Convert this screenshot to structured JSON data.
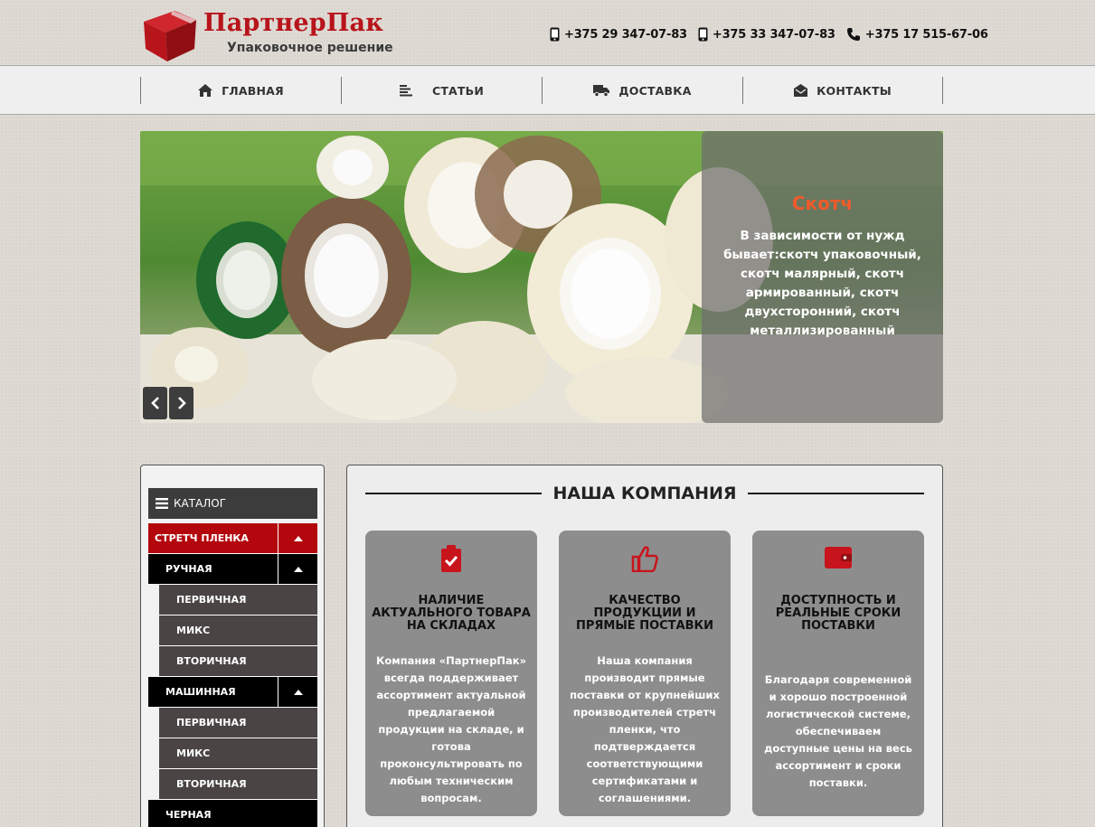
{
  "header": {
    "logo_title": "ПартнерПак",
    "logo_subtitle": "Упаковочное решение",
    "phones": [
      {
        "icon": "mobile-phone-icon",
        "number": "+375 29 347-07-83"
      },
      {
        "icon": "mobile-phone-icon",
        "number": "+375 33 347-07-83"
      },
      {
        "icon": "telephone-icon",
        "number": "+375 17 515-67-06"
      }
    ]
  },
  "nav": {
    "items": [
      {
        "label": "ГЛАВНАЯ",
        "icon": "home-icon"
      },
      {
        "label": "СТАТЬИ",
        "icon": "articles-icon"
      },
      {
        "label": "ДОСТАВКА",
        "icon": "truck-icon"
      },
      {
        "label": "КОНТАКТЫ",
        "icon": "envelope-icon"
      }
    ]
  },
  "slider": {
    "caption_title": "Скотч",
    "caption_text": "В зависимости от нужд бывает:скотч упаковочный, скотч малярный, скотч армированный, скотч двухсторонний, скотч металлизированный",
    "prev_icon": "chevron-left-icon",
    "next_icon": "chevron-right-icon"
  },
  "catalog": {
    "header": "КАТАЛОГ",
    "items": [
      {
        "label": "СТРЕТЧ ПЛЕНКА",
        "level": "red",
        "expanded": true
      },
      {
        "label": "РУЧНАЯ",
        "level": "black",
        "expanded": true
      },
      {
        "label": "ПЕРВИЧНАЯ",
        "level": "sub"
      },
      {
        "label": "МИКС",
        "level": "sub"
      },
      {
        "label": "ВТОРИЧНАЯ",
        "level": "sub"
      },
      {
        "label": "МАШИННАЯ",
        "level": "black",
        "expanded": true
      },
      {
        "label": "ПЕРВИЧНАЯ",
        "level": "sub"
      },
      {
        "label": "МИКС",
        "level": "sub"
      },
      {
        "label": "ВТОРИЧНАЯ",
        "level": "sub"
      },
      {
        "label": "ЧЕРНАЯ",
        "level": "top"
      }
    ]
  },
  "company": {
    "title": "НАША КОМПАНИЯ",
    "cards": [
      {
        "icon": "clipboard-check-icon",
        "title": "НАЛИЧИЕ АКТУАЛЬНОГО ТОВАРА НА СКЛАДАХ",
        "text": "Компания «ПартнерПак» всегда поддерживает ассортимент актуальной предлагаемой продукции на складе, и готова проконсультировать по любым техническим вопросам."
      },
      {
        "icon": "thumbs-up-icon",
        "title": "КАЧЕСТВО ПРОДУКЦИИ И ПРЯМЫЕ ПОСТАВКИ",
        "text": "Наша компания производит прямые поставки от крупнейших производителей стретч пленки, что подтверждается соответствующими сертификатами и соглашениями."
      },
      {
        "icon": "wallet-icon",
        "title": "ДОСТУПНОСТЬ И РЕАЛЬНЫЕ СРОКИ ПОСТАВКИ",
        "text": "Благодаря современной и хорошо построенной логистической системе, обеспечиваем доступные цены на весь ассортимент и сроки поставки."
      }
    ]
  },
  "colors": {
    "brand_red": "#b8141b",
    "caption_title": "#f05a2c",
    "card_bg": "#8d8d8d"
  }
}
